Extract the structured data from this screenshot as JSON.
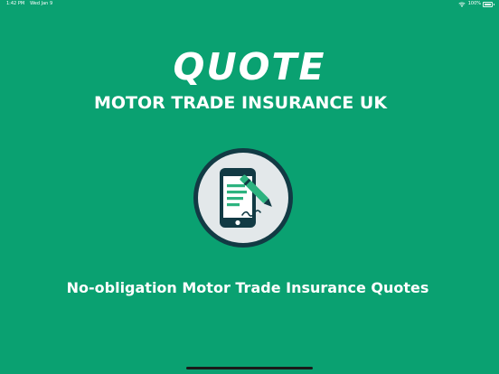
{
  "status_bar": {
    "time": "1:42 PM",
    "date": "Wed Jan 9",
    "battery_text": "100%",
    "battery_level": 1.0
  },
  "header": {
    "title": "QUOTE",
    "subtitle": "MOTOR TRADE INSURANCE UK"
  },
  "logo": {
    "icon": "tablet-signature-icon"
  },
  "tagline": "No-obligation Motor Trade Insurance Quotes",
  "colors": {
    "background": "#0aa171",
    "badge_ring": "#123a44",
    "badge_inner": "#e3e8ea",
    "accent_green": "#2db37f",
    "dark_icon": "#123a44"
  }
}
